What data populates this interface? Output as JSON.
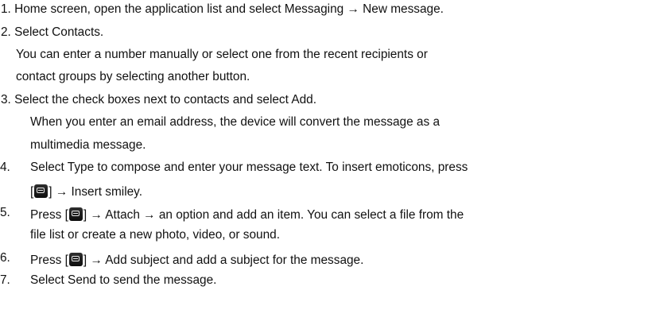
{
  "instructions": [
    {
      "num": "1.",
      "text": "Home screen, open the application list and select Messaging → New message."
    },
    {
      "num": "2.",
      "text": "Select Contacts."
    },
    {
      "note_line1": "You can enter a number manually or select one from the recent recipients or",
      "note_line2": "contact groups by selecting another button."
    },
    {
      "num": "3.",
      "text": "Select the check boxes next to contacts and select Add."
    },
    {
      "note_line1": "When you enter an email address, the device will convert the message as a",
      "note_line2": "multimedia message."
    },
    {
      "num": "4.",
      "text_a": "Select Type to compose and enter your message text. To insert emoticons, press",
      "text_b_pre": "[",
      "text_b_post": "] → Insert smiley."
    },
    {
      "num": "5.",
      "text_pre": "Press [",
      "text_post": "] → Attach → an option and add an item. You can select a file from the",
      "text_line2": "file list or create a new photo, video, or sound."
    },
    {
      "num": "6.",
      "text_pre": "Press [",
      "text_post": "] → Add subject and add a subject for the message."
    },
    {
      "num": "7.",
      "text": "Select Send to send the message."
    }
  ],
  "icons": {
    "menu_key": "menu-key-icon"
  }
}
